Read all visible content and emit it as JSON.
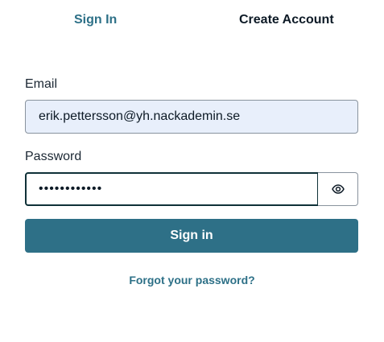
{
  "tabs": {
    "sign_in": "Sign In",
    "create_account": "Create Account",
    "active": "sign_in"
  },
  "form": {
    "email_label": "Email",
    "email_value": "erik.pettersson@yh.nackademin.se",
    "password_label": "Password",
    "password_value": "••••••••••••",
    "show_password_icon": "eye-icon",
    "submit_label": "Sign in",
    "forgot_password_label": "Forgot your password?"
  },
  "colors": {
    "accent": "#2e7087",
    "email_field_bg": "#e8effb",
    "focused_border": "#0f3138",
    "text": "#0d1a26"
  }
}
